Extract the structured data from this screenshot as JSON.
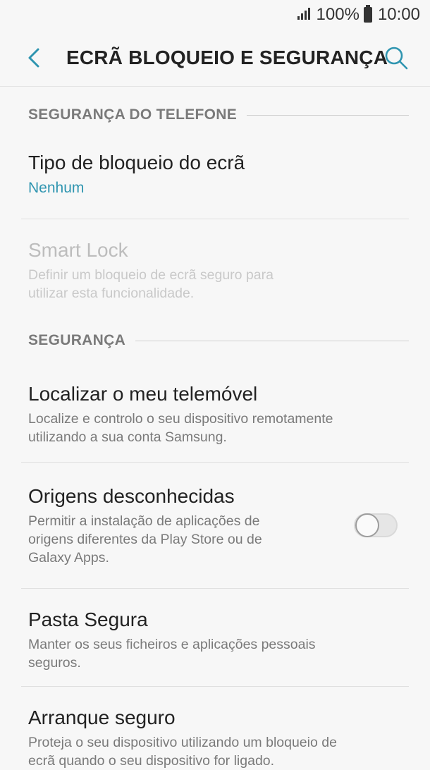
{
  "status": {
    "battery": "100%",
    "time": "10:00"
  },
  "appbar": {
    "title": "ECRÃ BLOQUEIO E SEGURANÇA"
  },
  "sections": {
    "phone_security": "SEGURANÇA DO TELEFONE",
    "security": "SEGURANÇA"
  },
  "items": {
    "lock_type": {
      "title": "Tipo de bloqueio do ecrã",
      "value": "Nenhum"
    },
    "smart_lock": {
      "title": "Smart Lock",
      "subtitle_line1": "Definir um bloqueio de ecrã seguro para",
      "subtitle_line2": "utilizar esta funcionalidade."
    },
    "find_my_mobile": {
      "title": "Localizar o meu telemóvel",
      "subtitle_line1": "Localize e controlo o seu dispositivo remotamente",
      "subtitle_line2": "utilizando a sua conta Samsung."
    },
    "unknown_sources": {
      "title": "Origens desconhecidas",
      "subtitle_line1": "Permitir a instalação de aplicações de",
      "subtitle_line2": "origens diferentes da Play Store ou de",
      "subtitle_line3": "Galaxy Apps.",
      "enabled": false
    },
    "secure_folder": {
      "title": "Pasta Segura",
      "subtitle_line1": "Manter os seus ficheiros e aplicações pessoais",
      "subtitle_line2": "seguros."
    },
    "secure_startup": {
      "title": "Arranque seguro",
      "subtitle_line1": "Proteja o seu dispositivo utilizando um bloqueio de",
      "subtitle_line2": "ecrã quando o seu dispositivo for ligado."
    }
  },
  "colors": {
    "accent": "#2f95b0",
    "background": "#f7f7f7"
  }
}
